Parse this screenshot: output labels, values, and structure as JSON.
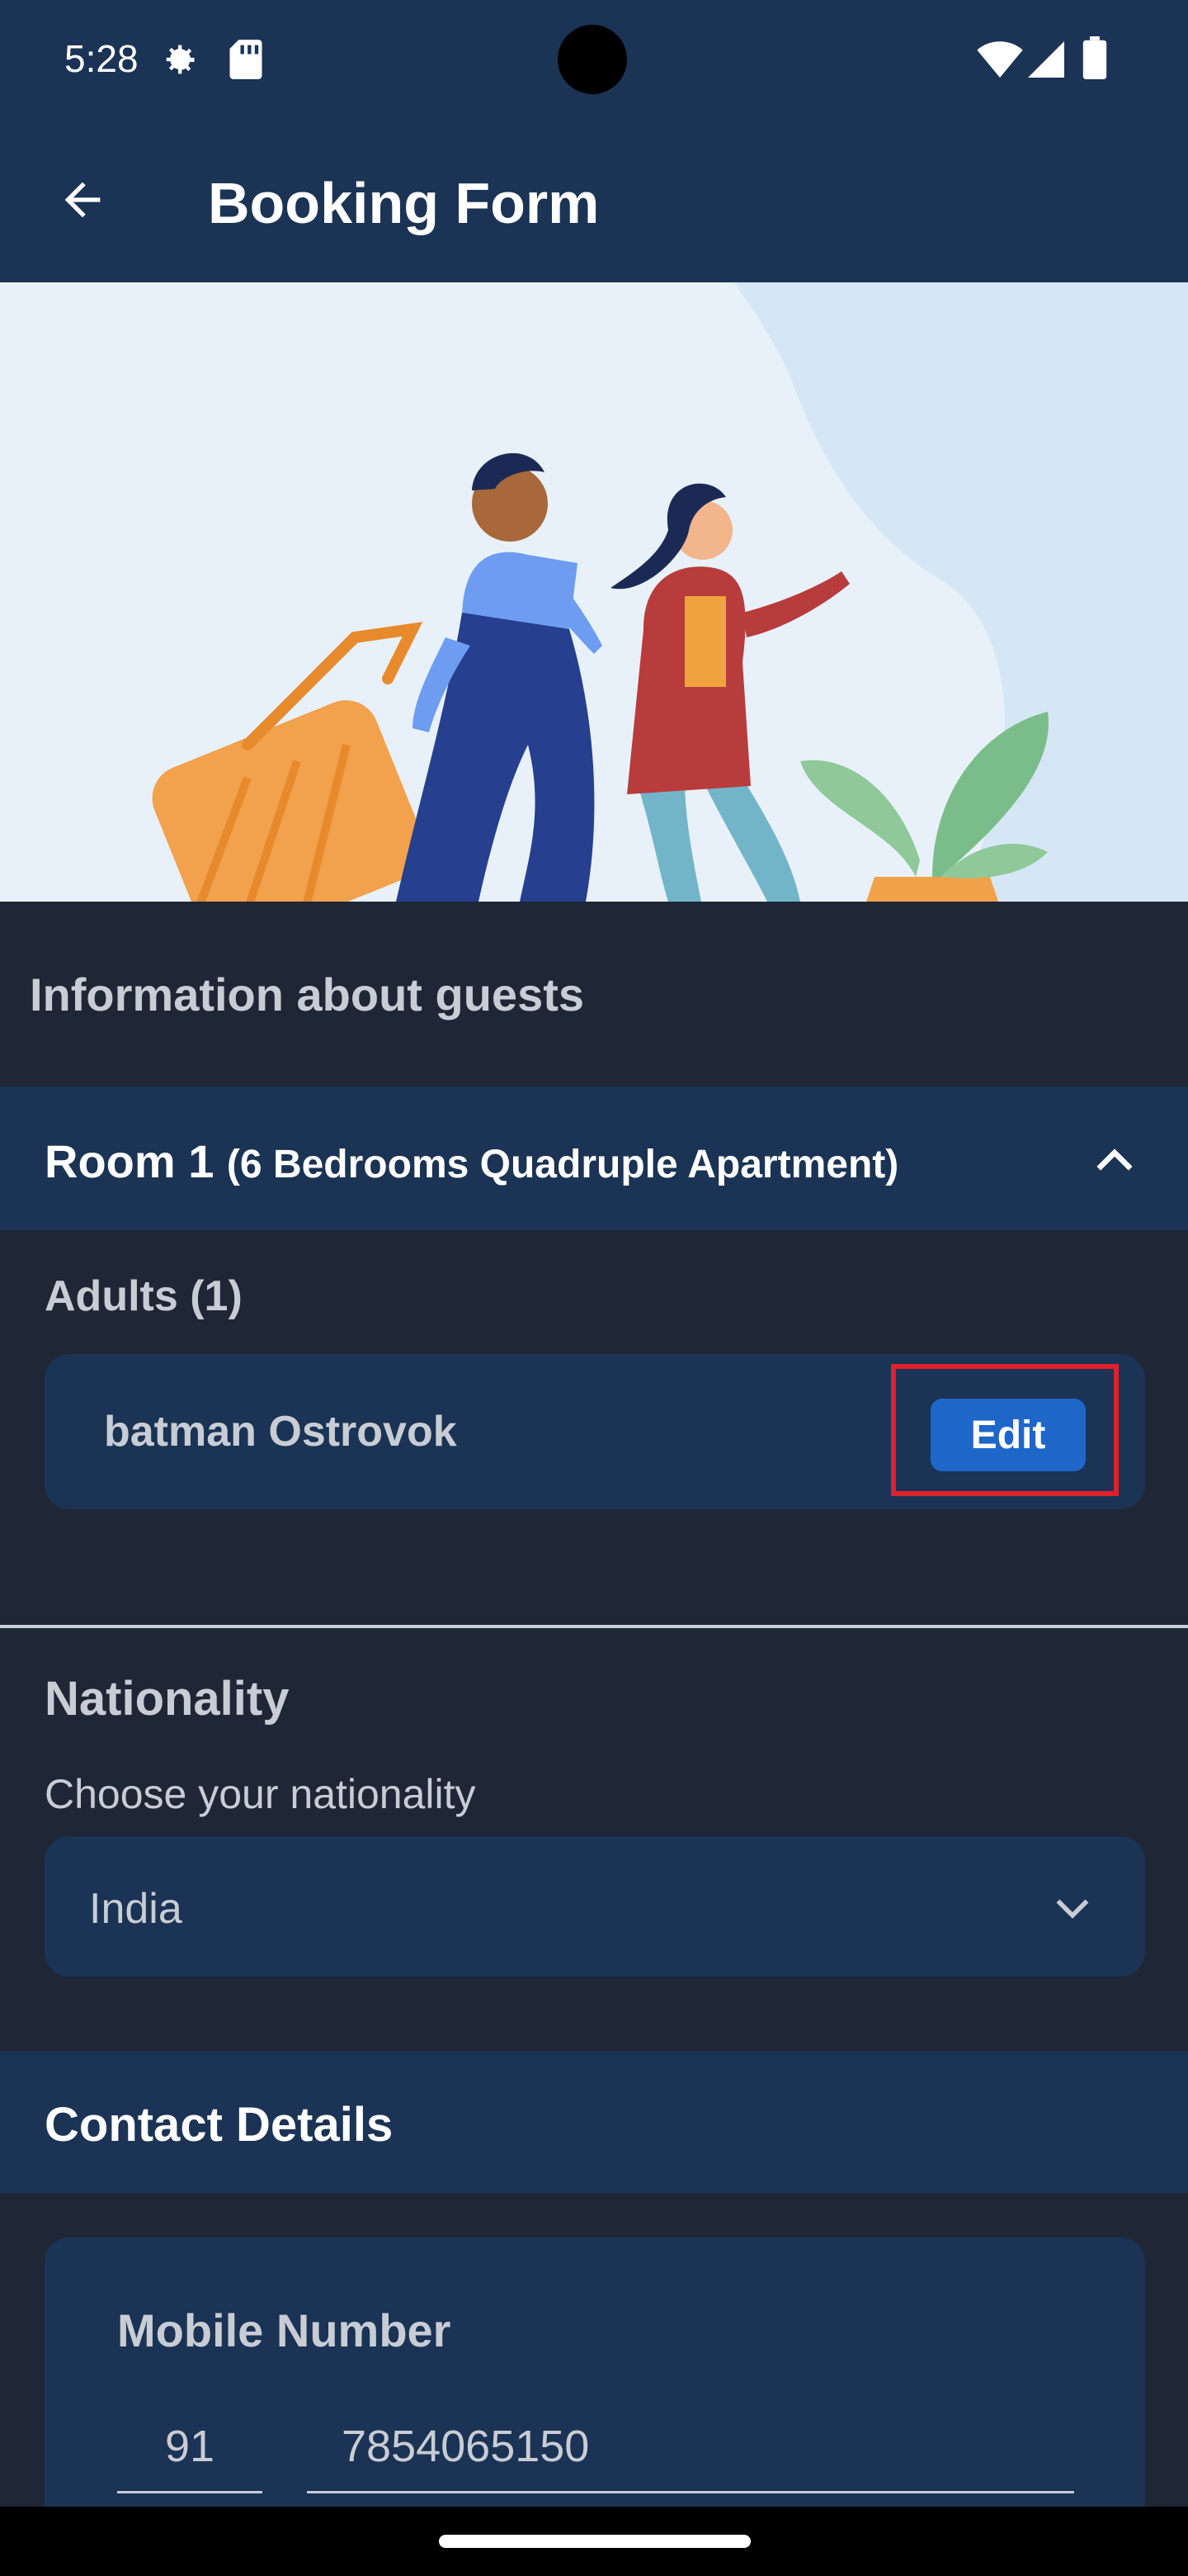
{
  "status_bar": {
    "time": "5:28",
    "icons": [
      "gear-icon",
      "sd-card-icon",
      "wifi-icon",
      "signal-icon",
      "battery-icon"
    ]
  },
  "app_bar": {
    "title": "Booking Form",
    "back_icon": "arrow-left-icon"
  },
  "guests_section": {
    "title": "Information about guests",
    "room": {
      "label": "Room 1",
      "type": "(6 Bedrooms Quadruple Apartment)",
      "toggle_icon": "chevron-up-icon"
    },
    "adults_label": "Adults (1)",
    "guests": [
      {
        "name": "batman Ostrovok",
        "edit_label": "Edit"
      }
    ]
  },
  "nationality": {
    "title": "Nationality",
    "hint": "Choose your nationality",
    "selected": "India",
    "dropdown_icon": "chevron-down-icon"
  },
  "contact": {
    "title": "Contact Details",
    "mobile_label": "Mobile Number",
    "country_code": "91",
    "phone_number": "7854065150"
  },
  "colors": {
    "app_bar": "#1b3354",
    "background": "#1f2636",
    "accent_button": "#1f66c9",
    "highlight": "#e0202c"
  }
}
